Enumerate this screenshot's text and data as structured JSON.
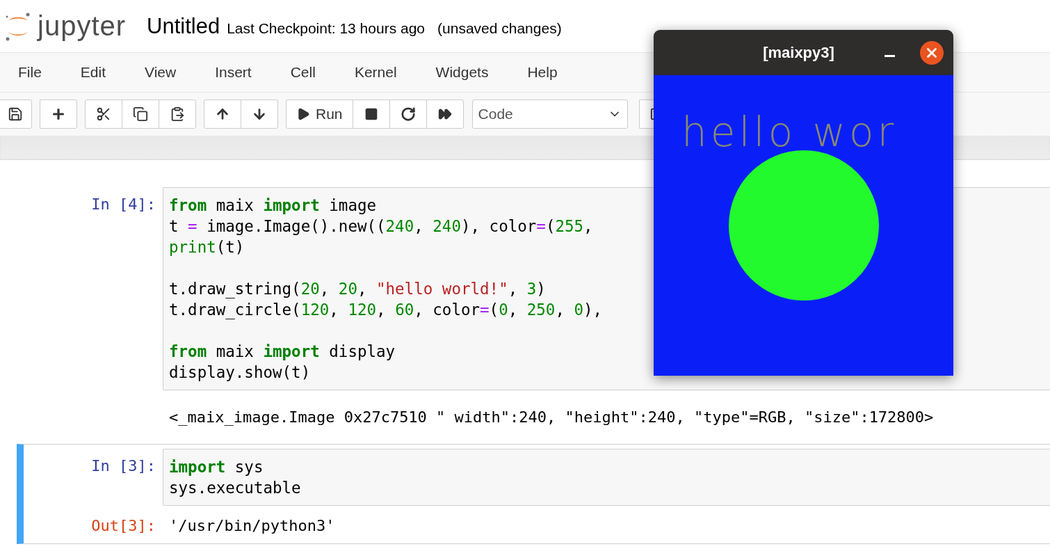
{
  "header": {
    "logo_text": "jupyter",
    "notebook_name": "Untitled",
    "checkpoint": "Last Checkpoint: 13 hours ago",
    "save_status": "(unsaved changes)"
  },
  "menu": [
    "File",
    "Edit",
    "View",
    "Insert",
    "Cell",
    "Kernel",
    "Widgets",
    "Help"
  ],
  "toolbar": {
    "run_label": "Run",
    "cell_type": "Code"
  },
  "cells": [
    {
      "prompt": "In [4]:",
      "selected": false,
      "lines": [
        {
          "kind": "code",
          "tokens": [
            {
              "text": "from",
              "kind": "kw"
            },
            {
              "text": " maix ",
              "kind": "plain"
            },
            {
              "text": "import",
              "kind": "kw"
            },
            {
              "text": " image",
              "kind": "plain"
            }
          ]
        },
        {
          "kind": "code",
          "tokens": [
            {
              "text": "t ",
              "kind": "plain"
            },
            {
              "text": "=",
              "kind": "op"
            },
            {
              "text": " image.Image().new((",
              "kind": "plain"
            },
            {
              "text": "240",
              "kind": "num"
            },
            {
              "text": ", ",
              "kind": "plain"
            },
            {
              "text": "240",
              "kind": "num"
            },
            {
              "text": "), color",
              "kind": "plain"
            },
            {
              "text": "=",
              "kind": "op"
            },
            {
              "text": "(",
              "kind": "plain"
            },
            {
              "text": "255",
              "kind": "num"
            },
            {
              "text": ",",
              "kind": "plain"
            }
          ]
        },
        {
          "kind": "code",
          "tokens": [
            {
              "text": "print",
              "kind": "builtin"
            },
            {
              "text": "(t)",
              "kind": "plain"
            }
          ]
        },
        {
          "kind": "blank"
        },
        {
          "kind": "code",
          "tokens": [
            {
              "text": "t.draw_string(",
              "kind": "plain"
            },
            {
              "text": "20",
              "kind": "num"
            },
            {
              "text": ", ",
              "kind": "plain"
            },
            {
              "text": "20",
              "kind": "num"
            },
            {
              "text": ", ",
              "kind": "plain"
            },
            {
              "text": "\"hello world!\"",
              "kind": "str"
            },
            {
              "text": ", ",
              "kind": "plain"
            },
            {
              "text": "3",
              "kind": "num"
            },
            {
              "text": ")",
              "kind": "plain"
            }
          ]
        },
        {
          "kind": "code",
          "tokens": [
            {
              "text": "t.draw_circle(",
              "kind": "plain"
            },
            {
              "text": "120",
              "kind": "num"
            },
            {
              "text": ", ",
              "kind": "plain"
            },
            {
              "text": "120",
              "kind": "num"
            },
            {
              "text": ", ",
              "kind": "plain"
            },
            {
              "text": "60",
              "kind": "num"
            },
            {
              "text": ", color",
              "kind": "plain"
            },
            {
              "text": "=",
              "kind": "op"
            },
            {
              "text": "(",
              "kind": "plain"
            },
            {
              "text": "0",
              "kind": "num"
            },
            {
              "text": ", ",
              "kind": "plain"
            },
            {
              "text": "250",
              "kind": "num"
            },
            {
              "text": ", ",
              "kind": "plain"
            },
            {
              "text": "0",
              "kind": "num"
            },
            {
              "text": "),",
              "kind": "plain"
            }
          ]
        },
        {
          "kind": "blank"
        },
        {
          "kind": "code",
          "tokens": [
            {
              "text": "from",
              "kind": "kw"
            },
            {
              "text": " maix ",
              "kind": "plain"
            },
            {
              "text": "import",
              "kind": "kw"
            },
            {
              "text": " display",
              "kind": "plain"
            }
          ]
        },
        {
          "kind": "code",
          "tokens": [
            {
              "text": "display.show(t)",
              "kind": "plain"
            }
          ]
        }
      ],
      "output": {
        "text": "<_maix_image.Image 0x27c7510 \" width\":240, \"height\":240, \"type\"=RGB, \"size\":172800>"
      }
    },
    {
      "prompt": "In [3]:",
      "selected": true,
      "lines": [
        {
          "kind": "code",
          "tokens": [
            {
              "text": "import",
              "kind": "kw"
            },
            {
              "text": " sys",
              "kind": "plain"
            }
          ]
        },
        {
          "kind": "code",
          "tokens": [
            {
              "text": "sys.executable",
              "kind": "plain"
            }
          ]
        }
      ],
      "output": {
        "prompt": "Out[3]:",
        "text": "'/usr/bin/python3'"
      }
    }
  ],
  "popup": {
    "title": "[maixpy3]",
    "display_text": "hello wor"
  }
}
